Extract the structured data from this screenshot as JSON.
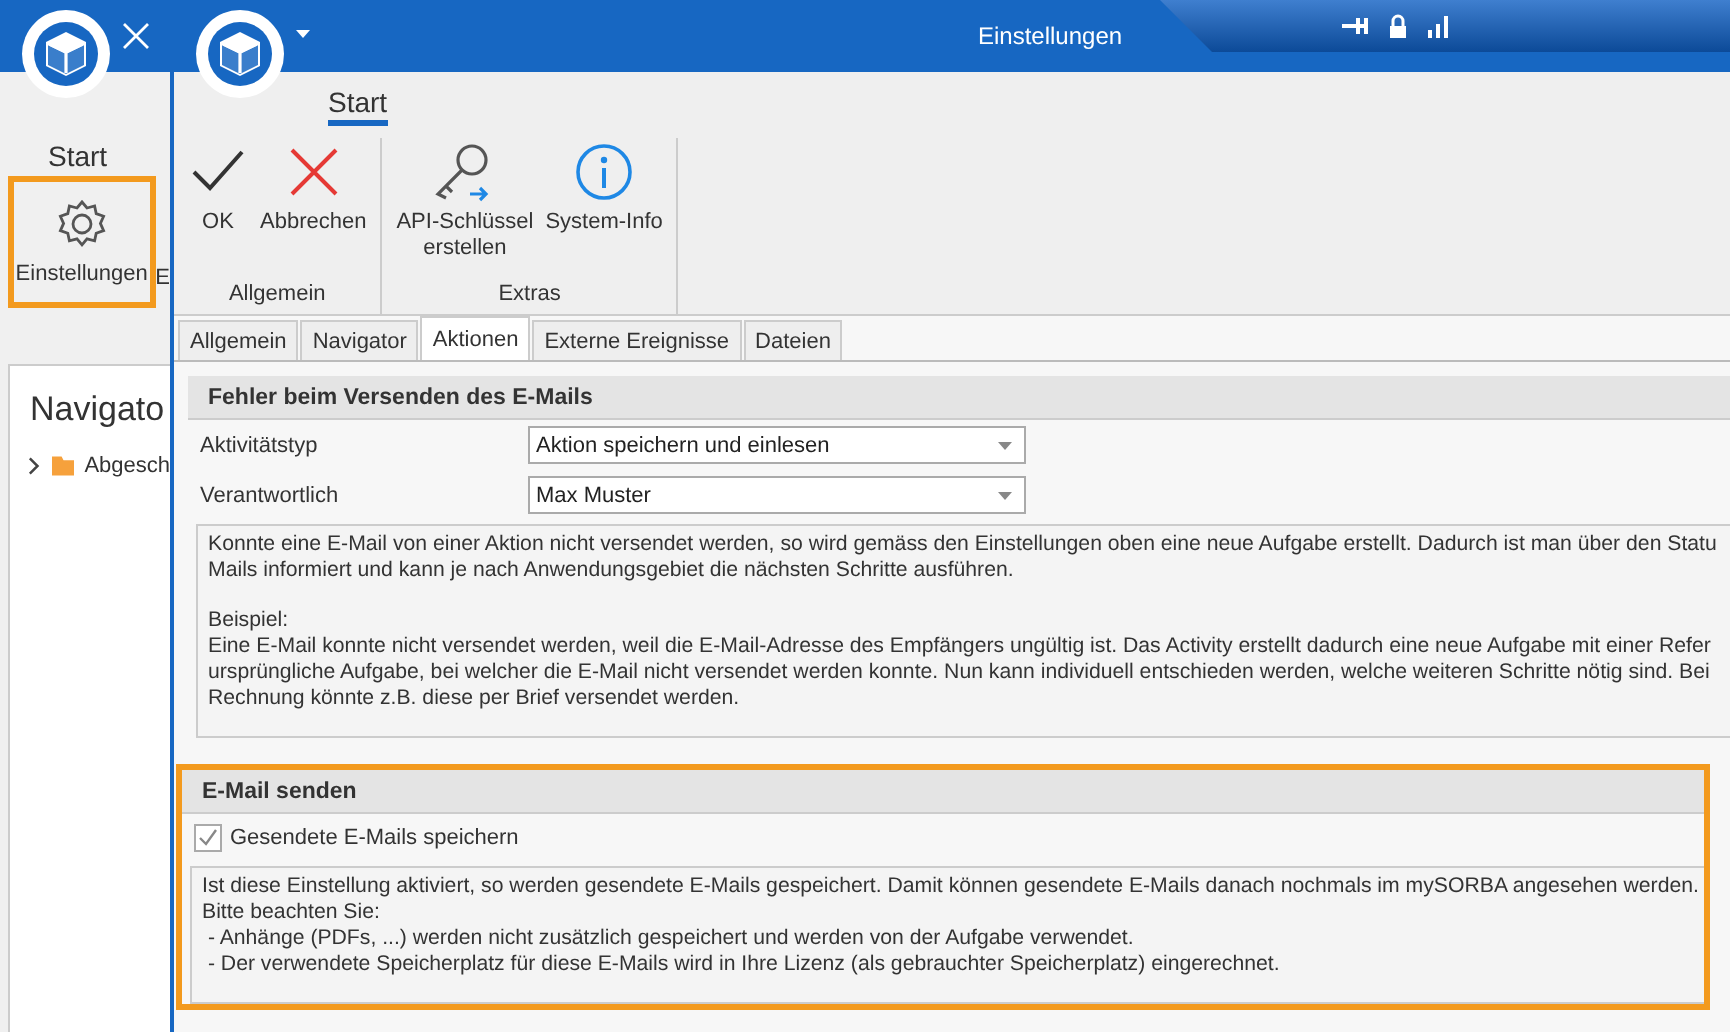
{
  "back_window": {
    "ribbon_tab": "Start",
    "button": {
      "label": "Einstellungen",
      "highlighted": true
    },
    "cut_label": "E",
    "navigator_title": "Navigato",
    "tree": [
      {
        "label": "Abgesch",
        "expanded": false
      }
    ]
  },
  "window": {
    "title": "Einstellungen"
  },
  "ribbon": {
    "tab": "Start",
    "groups": [
      {
        "name": "Allgemein",
        "buttons": [
          {
            "label": "OK",
            "kind": "check"
          },
          {
            "label": "Abbrechen",
            "kind": "cross"
          }
        ]
      },
      {
        "name": "Extras",
        "buttons": [
          {
            "label": "API-Schlüssel\nerstellen",
            "kind": "key"
          },
          {
            "label": "System-Info",
            "kind": "info"
          }
        ]
      }
    ]
  },
  "tabs": [
    {
      "label": "Allgemein",
      "selected": false
    },
    {
      "label": "Navigator",
      "selected": false
    },
    {
      "label": "Aktionen",
      "selected": true
    },
    {
      "label": "Externe Ereignisse",
      "selected": false
    },
    {
      "label": "Dateien",
      "selected": false
    }
  ],
  "sections": [
    {
      "title": "Fehler beim Versenden des E-Mails",
      "highlighted": false,
      "fields": [
        {
          "label": "Aktivitätstyp",
          "value": "Aktion speichern und einlesen"
        },
        {
          "label": "Verantwortlich",
          "value": "Max Muster"
        }
      ],
      "paragraphs": [
        [
          "Konnte eine E-Mail von einer Aktion nicht versendet werden, so wird gemäss den Einstellungen oben eine neue Aufgabe erstellt. Dadurch ist man über den Statu",
          "Mails informiert und kann je nach Anwendungsgebiet die nächsten Schritte ausführen."
        ],
        [
          "Beispiel:",
          "Eine E-Mail konnte nicht versendet werden, weil die E-Mail-Adresse des Empfängers ungültig ist. Das Activity erstellt dadurch eine neue Aufgabe mit einer Refer",
          "ursprüngliche Aufgabe, bei welcher die E-Mail nicht versendet werden konnte. Nun kann individuell entschieden werden, welche weiteren Schritte nötig sind. Bei",
          "Rechnung könnte z.B. diese per Brief versendet werden."
        ]
      ]
    },
    {
      "title": "E-Mail senden",
      "highlighted": true,
      "checkbox": {
        "label": "Gesendete E-Mails speichern",
        "checked": true
      },
      "paragraphs": [
        [
          "Ist diese Einstellung aktiviert, so werden gesendete E-Mails gespeichert. Damit können gesendete E-Mails danach nochmals im mySORBA angesehen werden.",
          "Bitte beachten Sie:",
          " - Anhänge (PDFs, ...) werden nicht zusätzlich gespeichert und werden von der Aufgabe verwendet.",
          " - Der verwendete Speicherplatz für diese E-Mails wird in Ihre Lizenz (als gebrauchter Speicherplatz) eingerechnet."
        ]
      ]
    }
  ]
}
